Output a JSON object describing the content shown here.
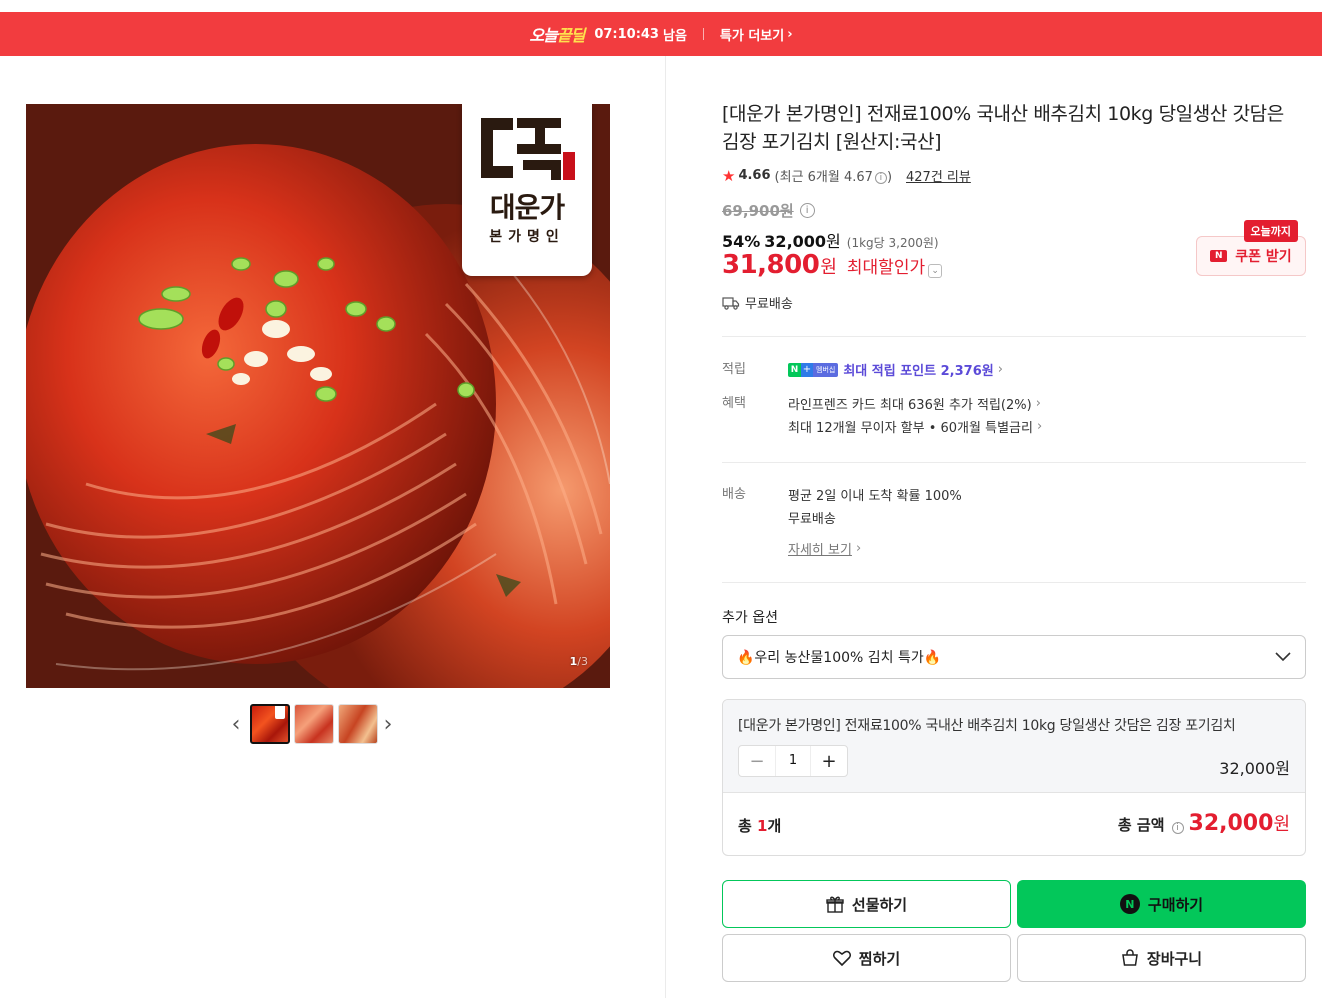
{
  "deal_bar": {
    "logo_prefix": "오늘",
    "logo_highlight": "끝딜",
    "timer": "07:10:43",
    "timer_suffix": "남음",
    "more_label": "특가 더보기"
  },
  "gallery": {
    "counter_current": "1",
    "counter_total": "/3",
    "brand_name": "대운가",
    "brand_sub": "본가명인",
    "thumbnails": 3,
    "active_index": 0
  },
  "product": {
    "title": "[대운가 본가명인] 전재료100% 국내산 배추김치 10kg 당일생산 갓담은 김장 포기김치 [원산지:국산]",
    "rating": "4.66",
    "recent_rating_prefix": "(최근 6개월 4.67",
    "recent_rating_suffix": ")",
    "review_count": "427건 리뷰",
    "original_price": "69,900원",
    "discount_rate": "54%",
    "sale_price": "32,000",
    "sale_unit": "원",
    "unit_price": "(1kg당 3,200원)",
    "max_price": "31,800",
    "max_unit": "원",
    "max_label": "최대할인가",
    "coupon_tag": "오늘까지",
    "coupon_label": "쿠폰 받기",
    "shipping": "무료배송"
  },
  "benefits": {
    "point_label": "적립",
    "point_text": "최대 적립 포인트 2,376원",
    "membership_badge": "멤버십",
    "benefit_label": "혜택",
    "benefit_lines": [
      "라인프렌즈 카드 최대 636원 추가 적립(2%)",
      "최대 12개월 무이자 할부 • 60개월 특별금리"
    ]
  },
  "delivery": {
    "label": "배송",
    "line1": "평균 2일 이내 도착 확률 100%",
    "line2": "무료배송",
    "detail_link": "자세히 보기"
  },
  "options": {
    "title": "추가 옵션",
    "selected": "🔥우리 농산물100% 김치 특가🔥"
  },
  "selection": {
    "name": "[대운가 본가명인] 전재료100% 국내산 배추김치 10kg 당일생산 갓담은 김장 포기김치",
    "minus": "−",
    "quantity": "1",
    "plus": "+",
    "price": "32,000원",
    "total_count_prefix": "총 ",
    "total_count_num": "1",
    "total_count_suffix": "개",
    "total_label": "총 금액",
    "total_price": "32,000",
    "total_unit": "원"
  },
  "actions": {
    "gift": "선물하기",
    "buy": "구매하기",
    "wish": "찜하기",
    "cart": "장바구니"
  },
  "colors": {
    "deal_red": "#f23c3f",
    "price_red": "#e31e30",
    "naver_green": "#03c75a",
    "point_purple": "#5b4ad8"
  }
}
